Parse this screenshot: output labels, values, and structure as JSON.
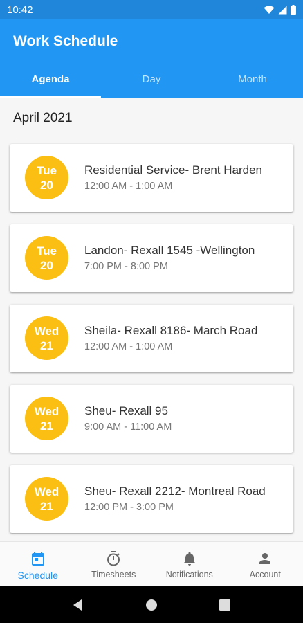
{
  "status_bar": {
    "time": "10:42"
  },
  "app": {
    "title": "Work Schedule"
  },
  "tabs": [
    {
      "label": "Agenda",
      "active": true
    },
    {
      "label": "Day",
      "active": false
    },
    {
      "label": "Month",
      "active": false
    }
  ],
  "agenda": {
    "month_label": "April 2021",
    "events": [
      {
        "day": "Tue",
        "date": "20",
        "title": "Residential Service- Brent Harden",
        "time": "12:00 AM - 1:00 AM"
      },
      {
        "day": "Tue",
        "date": "20",
        "title": "Landon- Rexall 1545 -Wellington",
        "time": "7:00 PM - 8:00 PM"
      },
      {
        "day": "Wed",
        "date": "21",
        "title": "Sheila- Rexall 8186- March Road",
        "time": "12:00 AM - 1:00 AM"
      },
      {
        "day": "Wed",
        "date": "21",
        "title": "Sheu- Rexall 95",
        "time": "9:00 AM - 11:00 AM"
      },
      {
        "day": "Wed",
        "date": "21",
        "title": "Sheu- Rexall 2212- Montreal Road",
        "time": "12:00 PM - 3:00 PM"
      }
    ]
  },
  "bottom_nav": [
    {
      "label": "Schedule",
      "icon": "calendar-icon",
      "active": true
    },
    {
      "label": "Timesheets",
      "icon": "stopwatch-icon",
      "active": false
    },
    {
      "label": "Notifications",
      "icon": "bell-icon",
      "active": false
    },
    {
      "label": "Account",
      "icon": "person-icon",
      "active": false
    }
  ],
  "colors": {
    "primary": "#2196f3",
    "status_bar": "#1f86d9",
    "date_badge": "#fbbf13"
  }
}
